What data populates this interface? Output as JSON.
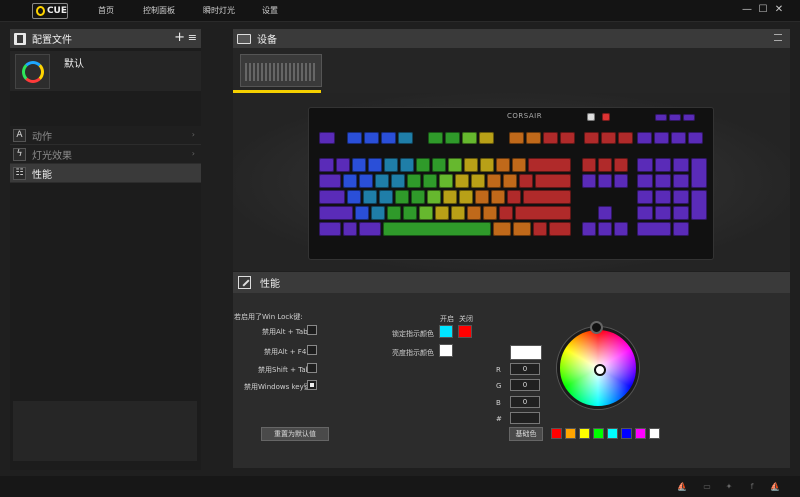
{
  "app": {
    "logo_text": "CUE",
    "nav": [
      "首页",
      "控制面板",
      "瞬时灯光",
      "设置"
    ],
    "window_controls": [
      "—",
      "☐",
      "✕"
    ]
  },
  "profiles": {
    "title": "配置文件",
    "add_label": "+",
    "menu_label": "≡",
    "current": "默认"
  },
  "sections": [
    {
      "label": "动作",
      "icon": "A"
    },
    {
      "label": "灯光效果",
      "icon": "ϟ"
    },
    {
      "label": "性能",
      "icon": "☷"
    }
  ],
  "devices": {
    "title": "设备",
    "brand": "CORSAIR"
  },
  "performance": {
    "title": "性能",
    "winlock_heading": "若启用了Win Lock键:",
    "options": [
      {
        "label": "禁用Alt + Tab",
        "checked": false
      },
      {
        "label": "禁用Alt + F4",
        "checked": false
      },
      {
        "label": "禁用Shift + Tab",
        "checked": false
      },
      {
        "label": "禁用Windows key键",
        "checked": true
      }
    ],
    "reset_label": "重置为默认值",
    "on_label": "开启",
    "off_label": "关闭",
    "lock_indicator_label": "锁定指示颜色",
    "lock_on_color": "#00e5ff",
    "lock_off_color": "#ff0000",
    "bright_indicator_label": "亮度指示颜色",
    "bright_color": "#ffffff",
    "preview_color": "#ffffff",
    "rgb": [
      {
        "label": "R",
        "value": "0"
      },
      {
        "label": "G",
        "value": "0"
      },
      {
        "label": "B",
        "value": "0"
      },
      {
        "label": "#",
        "value": ""
      }
    ],
    "basic_colors_label": "基础色",
    "basic_colors": [
      "#ff0000",
      "#ffa500",
      "#ffff00",
      "#00ff00",
      "#00ffff",
      "#0000ff",
      "#ff00ff",
      "#ffffff"
    ]
  },
  "theme": {
    "accent": "#f5d000"
  }
}
